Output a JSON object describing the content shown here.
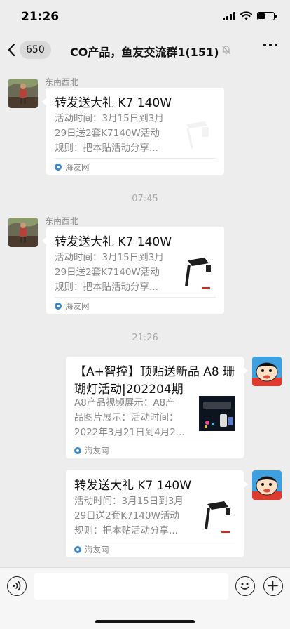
{
  "status": {
    "time": "21:26"
  },
  "nav": {
    "back_count": "650",
    "title": "CO产品，鱼友交流群1(151)"
  },
  "timestamps": [
    "07:45",
    "21:26"
  ],
  "messages": [
    {
      "sender": "东南西北",
      "title": "转发送大礼  K7 140W",
      "desc": [
        "活动时间：3月15日到3月",
        "29日送2套K7140W活动",
        "规则：把本贴活动分享..."
      ],
      "source": "海友网"
    },
    {
      "sender": "东南西北",
      "title": "转发送大礼  K7 140W",
      "desc": [
        "活动时间：3月15日到3月",
        "29日送2套K7140W活动",
        "规则：把本贴活动分享..."
      ],
      "source": "海友网"
    },
    {
      "title_lines": [
        "【A+智控】顶贴送新品 A8 珊",
        "瑚灯活动|202204期"
      ],
      "desc": [
        "A8产品视频展示：A8产",
        "品图片展示：活动时间：",
        "2022年3月21日到4月2..."
      ],
      "source": "海友网"
    },
    {
      "title": "转发送大礼  K7 140W",
      "desc": [
        "活动时间：3月15日到3月",
        "29日送2套K7140W活动",
        "规则：把本贴活动分享..."
      ],
      "source": "海友网"
    }
  ],
  "icons": {
    "back": "chevron-left-icon",
    "mute": "bell-muted-icon",
    "more": "more-icon",
    "voice": "voice-icon",
    "emoji": "emoji-icon",
    "plus": "plus-icon"
  },
  "colors": {
    "background": "#ededed",
    "card": "#ffffff",
    "muted_text": "#888888",
    "source_logo": "#3a86c8"
  }
}
